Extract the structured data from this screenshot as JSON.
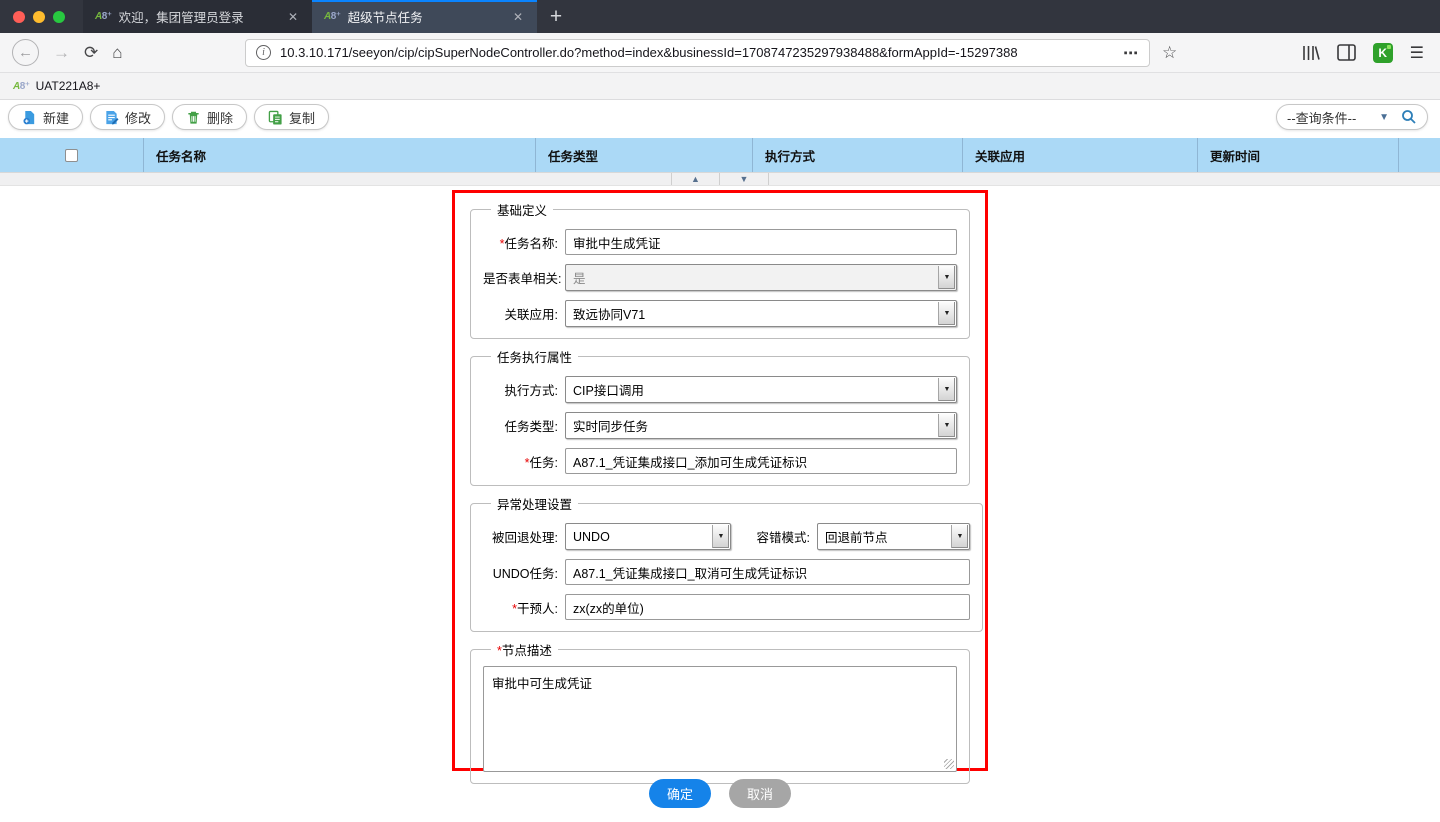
{
  "browser": {
    "favicon": {
      "part1": "A",
      "part2": "8⁺"
    },
    "tabs": [
      {
        "title": "欢迎，集团管理员登录"
      },
      {
        "title": "超级节点任务"
      }
    ],
    "close_icon": "✕",
    "new_tab_icon": "+",
    "nav": {
      "back_icon": "←",
      "forward_icon": "→",
      "reload_icon": "⟳",
      "home_icon": "⌂",
      "page_info_icon": "i",
      "url": "10.3.10.171/seeyon/cip/cipSuperNodeController.do?method=index&businessId=1708747235297938488&formAppId=-15297388",
      "page_actions_icon": "⋯",
      "bookmark_star_icon": "☆",
      "extension_icon": "K",
      "menu_icon": "☰"
    },
    "bookmarks_bar": {
      "items": [
        {
          "label": "UAT221A8+"
        }
      ]
    }
  },
  "toolbar": {
    "buttons": [
      {
        "label": "新建"
      },
      {
        "label": "修改"
      },
      {
        "label": "删除"
      },
      {
        "label": "复制"
      }
    ],
    "query": {
      "label": "--查询条件--",
      "chevron_icon": "▼"
    }
  },
  "table": {
    "columns": [
      "任务名称",
      "任务类型",
      "执行方式",
      "关联应用",
      "更新时间"
    ]
  },
  "splitter": {
    "up_icon": "▲",
    "down_icon": "▼"
  },
  "dialog": {
    "required_mark": "*",
    "basic": {
      "legend": "基础定义",
      "task_name": {
        "label": "任务名称:",
        "value": "审批中生成凭证"
      },
      "form_related": {
        "label": "是否表单相关:",
        "value": "是"
      },
      "related_app": {
        "label": "关联应用:",
        "value": "致远协同V71"
      }
    },
    "execution": {
      "legend": "任务执行属性",
      "exec_mode": {
        "label": "执行方式:",
        "value": "CIP接口调用"
      },
      "task_type": {
        "label": "任务类型:",
        "value": "实时同步任务"
      },
      "task": {
        "label": "任务:",
        "value": "A87.1_凭证集成接口_添加可生成凭证标识"
      }
    },
    "exception": {
      "legend": "异常处理设置",
      "rollback": {
        "label": "被回退处理:",
        "value": "UNDO"
      },
      "fault_mode": {
        "label": "容错模式:",
        "value": "回退前节点"
      },
      "undo_task": {
        "label": "UNDO任务:",
        "value": "A87.1_凭证集成接口_取消可生成凭证标识"
      },
      "intervener": {
        "label": "干预人:",
        "value": "zx(zx的单位)"
      }
    },
    "description": {
      "legend": "节点描述",
      "value": "审批中可生成凭证"
    },
    "buttons": {
      "ok": "确定",
      "cancel": "取消"
    }
  },
  "colors": {
    "tab_accent": "#0a84ff",
    "header_blue": "#abd9f6",
    "ok_blue": "#1583e9",
    "cancel_gray": "#a6a6a6",
    "annotation_red": "#fe0000",
    "icon_blue": "#3b9be0",
    "icon_green": "#43a047"
  }
}
